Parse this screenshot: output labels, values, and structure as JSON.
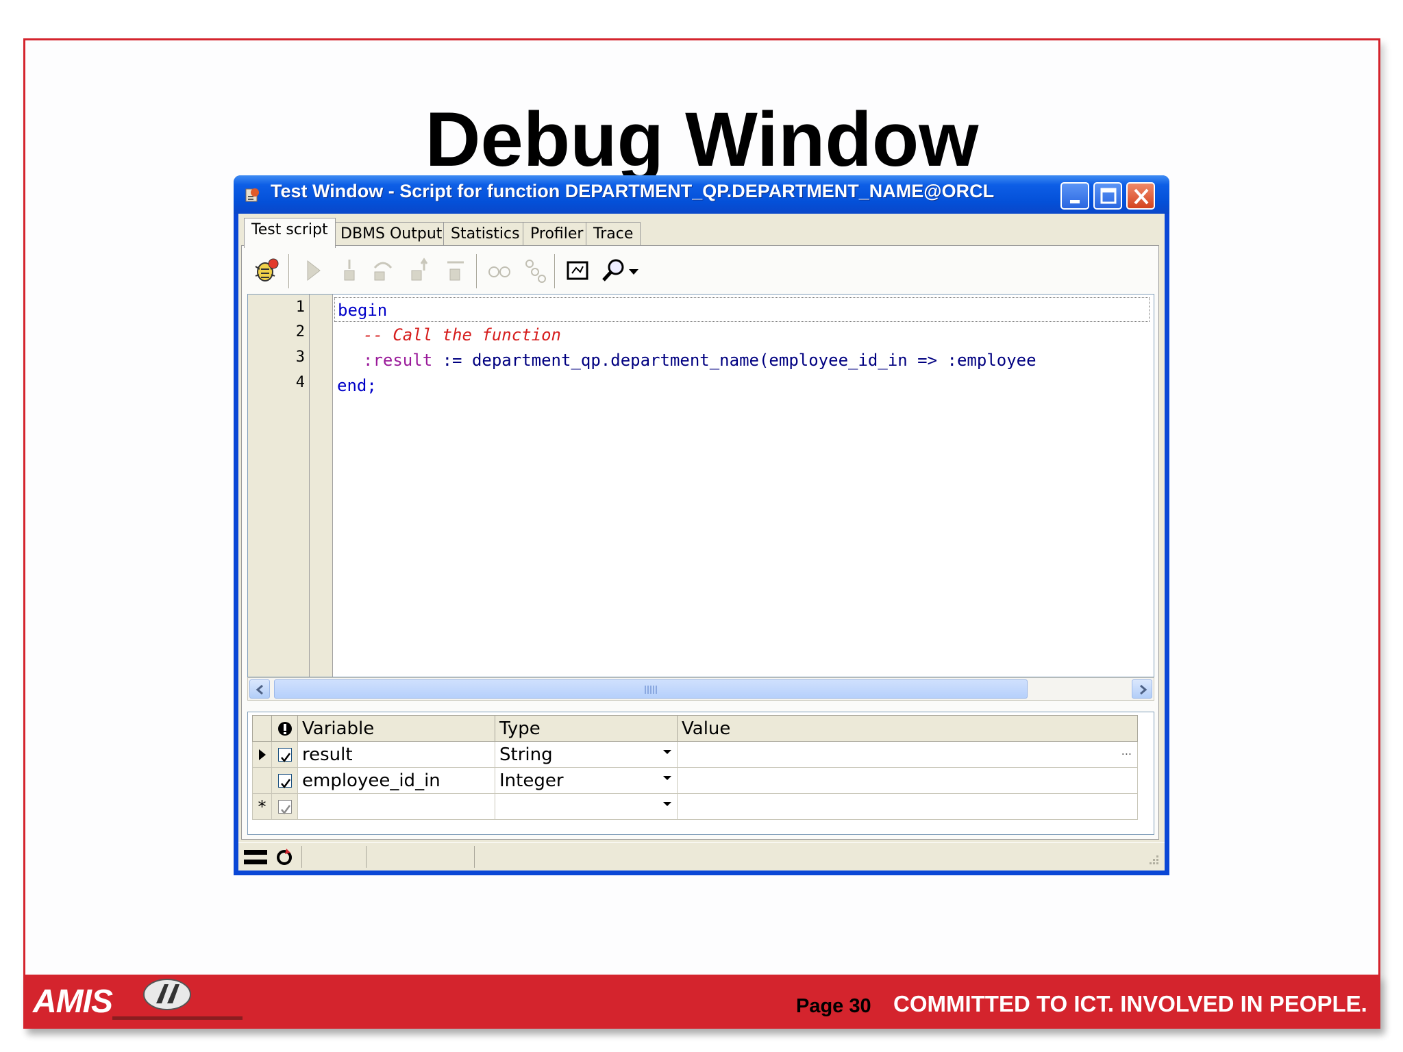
{
  "slide": {
    "title": "Debug Window",
    "page_label": "Page 30",
    "tagline": "COMMITTED TO ICT.  INVOLVED IN PEOPLE.",
    "logo_text": "AMIS",
    "accent_color": "#d4242d"
  },
  "window": {
    "title": "Test Window - Script for function DEPARTMENT_QP.DEPARTMENT_NAME@ORCL",
    "icon": "test-window-icon",
    "controls": [
      "minimize-icon",
      "maximize-icon",
      "close-icon"
    ]
  },
  "tabs": [
    {
      "label": "Test script",
      "active": true
    },
    {
      "label": "DBMS Output",
      "active": false
    },
    {
      "label": "Statistics",
      "active": false
    },
    {
      "label": "Profiler",
      "active": false
    },
    {
      "label": "Trace",
      "active": false
    }
  ],
  "toolbar": {
    "icons": [
      "debug-bug-icon",
      "run-icon",
      "step-into-icon",
      "step-over-icon",
      "step-out-icon",
      "run-to-exception-icon",
      "watch-glasses-icon",
      "breakpoints-icon",
      "output-window-icon",
      "find-magnifier-icon",
      "dropdown-arrow-icon"
    ]
  },
  "editor": {
    "line_numbers": [
      "1",
      "2",
      "3",
      "4"
    ],
    "lines": {
      "l1": "begin",
      "l2_comment": "-- Call the function",
      "l3_var": ":result",
      "l3_rest": " := department_qp.department_name(employee_id_in => :employee",
      "l4": "end;"
    }
  },
  "grid": {
    "columns": {
      "info_icon": "info-icon",
      "variable": "Variable",
      "type": "Type",
      "value": "Value"
    },
    "rows": [
      {
        "variable": "result",
        "type": "String",
        "value": "",
        "checked": true,
        "current": true
      },
      {
        "variable": "employee_id_in",
        "type": "Integer",
        "value": "",
        "checked": true,
        "current": false
      },
      {
        "variable": "",
        "type": "",
        "value": "",
        "checked": true,
        "current": false,
        "new_row_marker": "*"
      }
    ],
    "ellipsis": "..."
  },
  "statusbar": {
    "icons": [
      "layout-toggle-icon",
      "refresh-icon"
    ]
  }
}
